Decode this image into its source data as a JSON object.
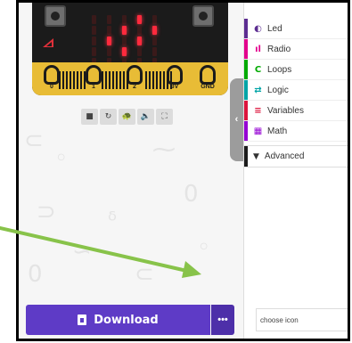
{
  "simulator": {
    "pins": [
      "0",
      "1",
      "2",
      "3V",
      "GND"
    ],
    "toolbar": [
      {
        "name": "stop-icon",
        "glyph": "■"
      },
      {
        "name": "restart-icon",
        "glyph": "↻"
      },
      {
        "name": "slow-motion-icon",
        "glyph": "🐢"
      },
      {
        "name": "sound-icon",
        "glyph": "🔈"
      },
      {
        "name": "fullscreen-icon",
        "glyph": "⛶"
      }
    ]
  },
  "toolbox": {
    "categories": [
      {
        "label": "Led",
        "color": "#5c2d91",
        "icon": "◐"
      },
      {
        "label": "Radio",
        "color": "#e3008c",
        "icon": "ıl"
      },
      {
        "label": "Loops",
        "color": "#00aa00",
        "icon": "C"
      },
      {
        "label": "Logic",
        "color": "#00a4a6",
        "icon": "⇄"
      },
      {
        "label": "Variables",
        "color": "#dc143c",
        "icon": "≡"
      },
      {
        "label": "Math",
        "color": "#9400d3",
        "icon": "▦"
      }
    ],
    "advanced_label": "Advanced"
  },
  "download_label": "Download",
  "more_label": "•••",
  "search_placeholder": "choose icon",
  "collapse_label": "‹"
}
